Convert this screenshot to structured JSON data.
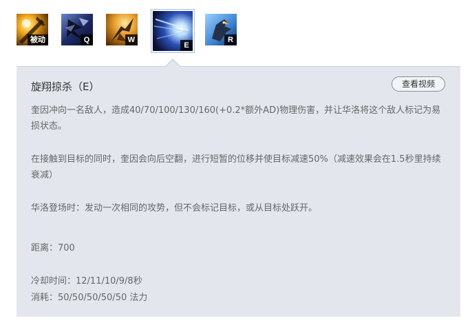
{
  "skills": [
    {
      "key": "被动",
      "icon": "passive-skill-icon",
      "selected": false
    },
    {
      "key": "Q",
      "icon": "q-skill-icon",
      "selected": false
    },
    {
      "key": "W",
      "icon": "w-skill-icon",
      "selected": false
    },
    {
      "key": "E",
      "icon": "e-skill-icon",
      "selected": true
    },
    {
      "key": "R",
      "icon": "r-skill-icon",
      "selected": false
    }
  ],
  "panel": {
    "title": "旋翔掠杀（E）",
    "video_button": "查看视频",
    "desc1": "奎因冲向一名敌人，造成40/70/100/130/160(+0.2*额外AD)物理伤害，并让华洛将这个敌人标记为易损状态。",
    "desc2": "在接触到目标的同时，奎因会向后空翻，进行短暂的位移并使目标减速50%（减速效果会在1.5秒里持续衰减）",
    "desc3": "华洛登场时：发动一次相同的攻势，但不会标记目标，或从目标处跃开。",
    "range": "距离：700",
    "cooldown": "冷却时间：12/11/10/9/8秒",
    "cost": "消耗：50/50/50/50/50 法力"
  },
  "colors": {
    "panel_bg": "#e3e7ed",
    "text": "#666666",
    "title": "#333333"
  }
}
